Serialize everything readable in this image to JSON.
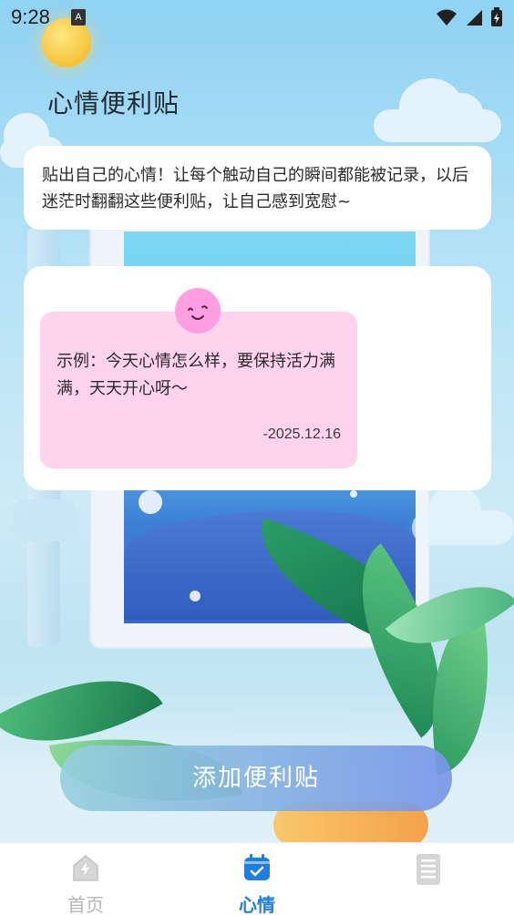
{
  "status_bar": {
    "time": "9:28",
    "notification_badge": "A",
    "icons": [
      "wifi-icon",
      "signal-icon",
      "battery-charging-icon"
    ]
  },
  "header": {
    "title": "心情便利贴"
  },
  "intro": {
    "text": "贴出自己的心情！让每个触动自己的瞬间都能被记录，以后迷茫时翻翻这些便利贴，让自己感到宽慰~"
  },
  "notes": [
    {
      "text": "示例：今天心情怎么样，要保持活力满满，天天开心呀～",
      "date": "-2025.12.16",
      "badge_icon": "smile-icon",
      "color": "#ffd3ee"
    }
  ],
  "actions": {
    "add_label": "添加便利贴"
  },
  "bottom_nav": {
    "items": [
      {
        "label": "首页",
        "icon": "home-icon",
        "active": false
      },
      {
        "label": "心情",
        "icon": "calendar-check-icon",
        "active": true
      },
      {
        "label": "",
        "icon": "document-list-icon",
        "active": false
      }
    ]
  },
  "colors": {
    "accent": "#1f7fe0",
    "note_pink": "#ffd3ee",
    "badge_pink": "#ff9ee0"
  }
}
